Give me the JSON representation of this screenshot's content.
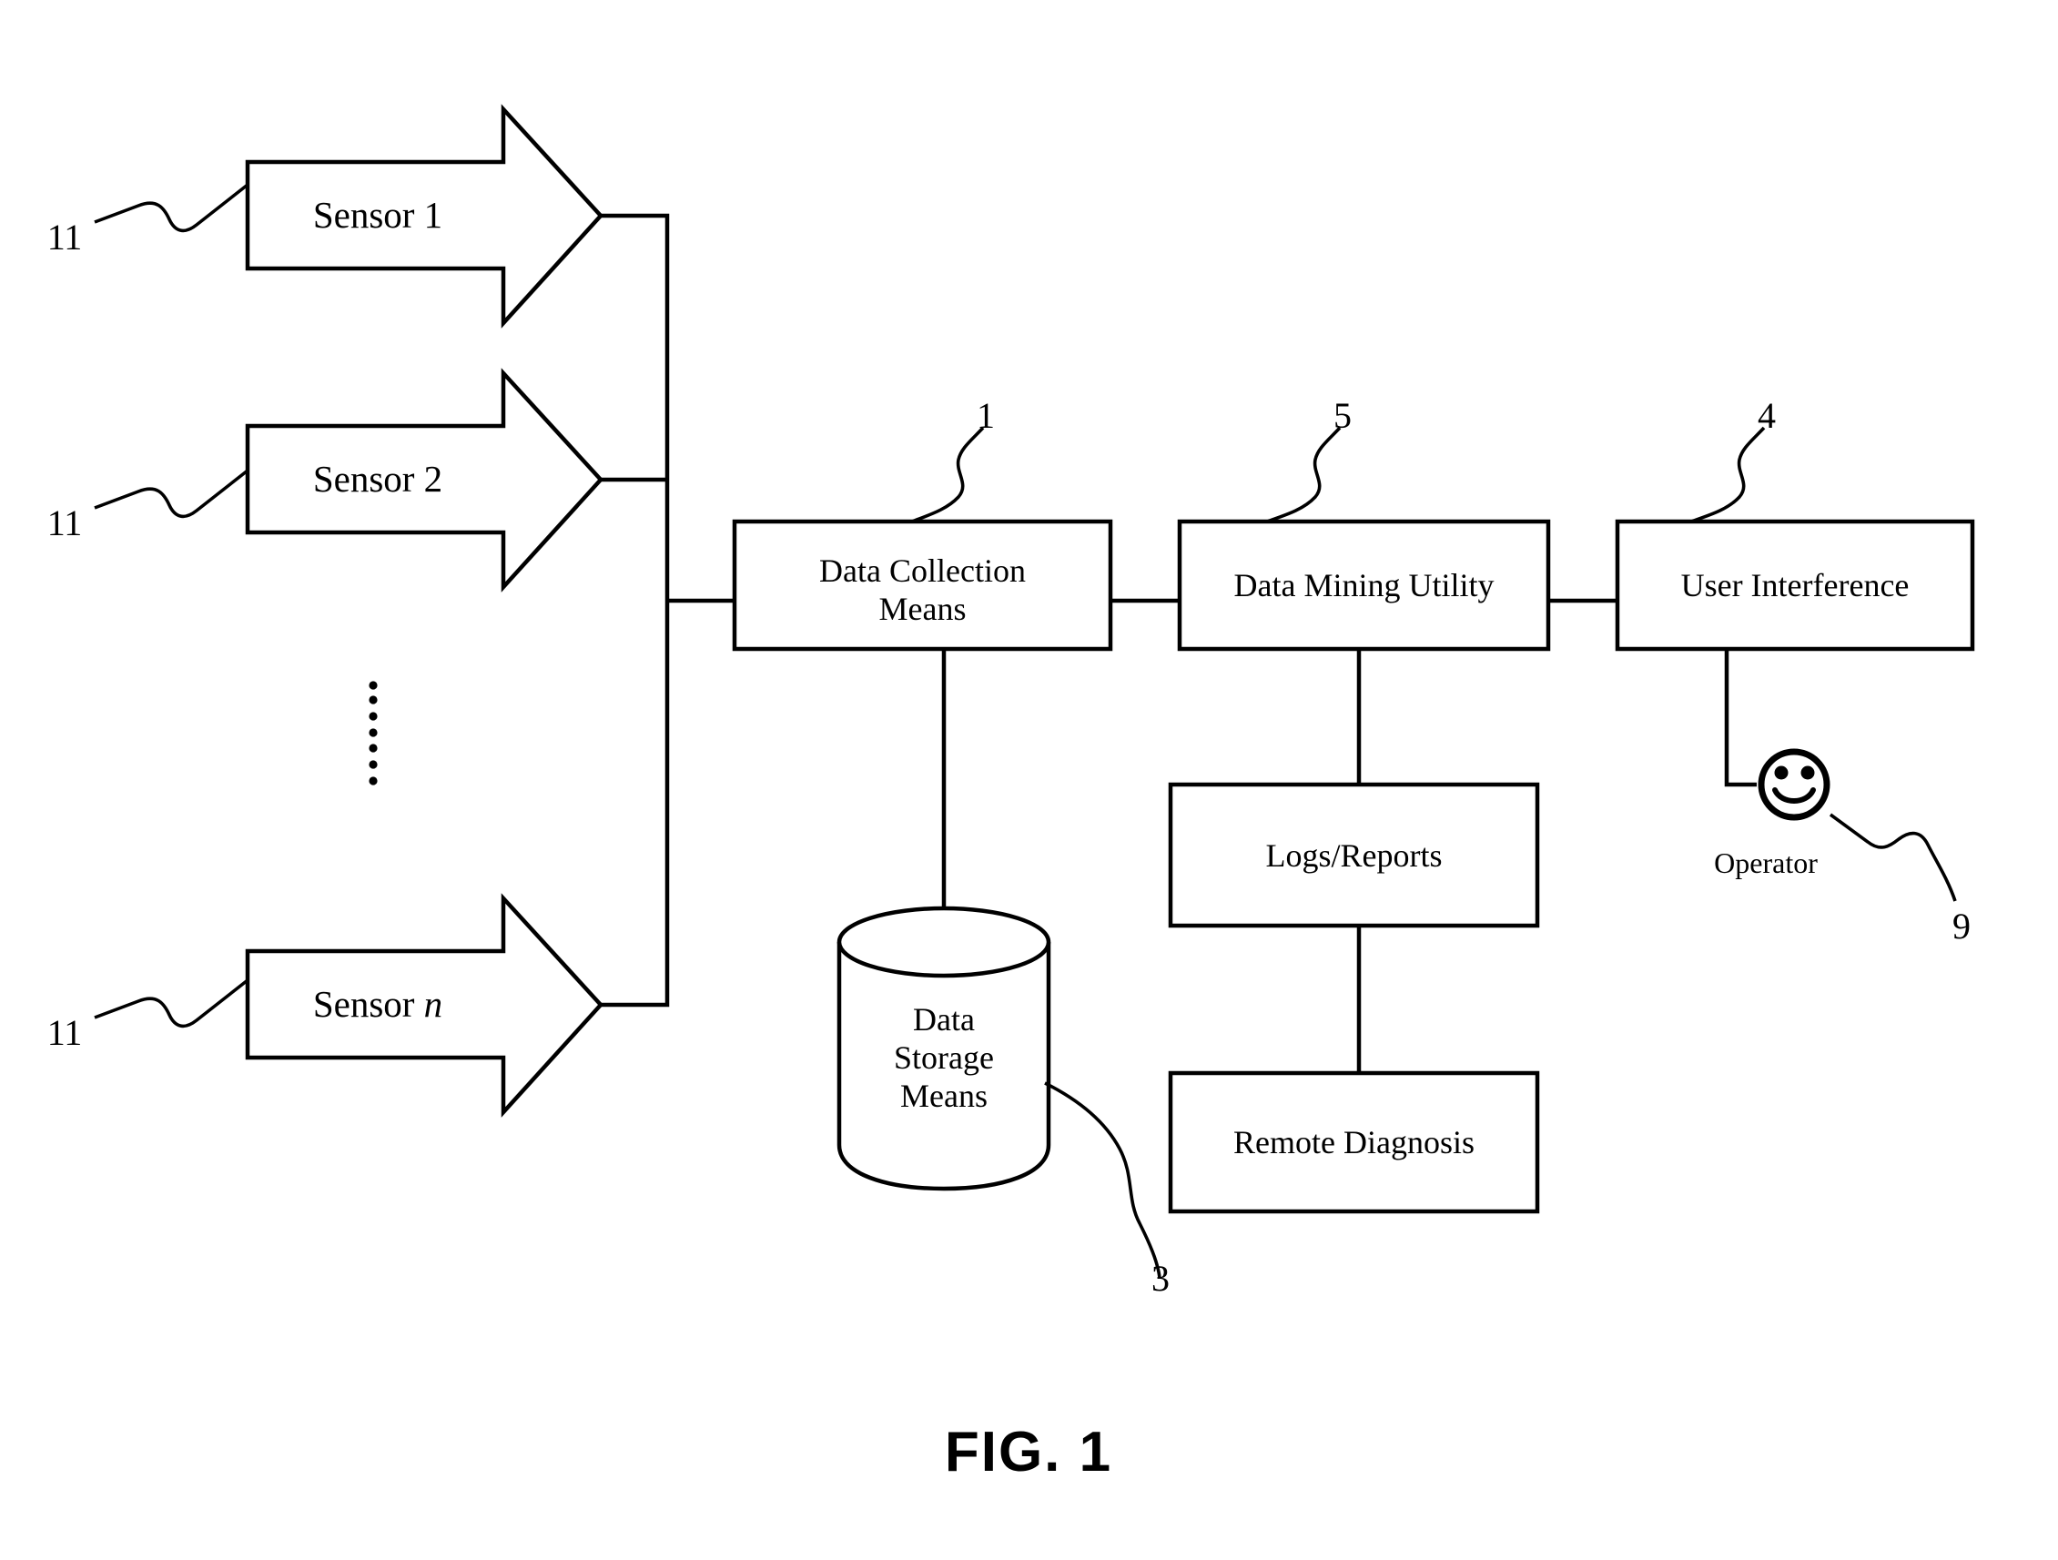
{
  "figure": {
    "caption": "FIG. 1",
    "title_visible": false
  },
  "sensors": [
    {
      "label_prefix": "Sensor ",
      "label_suffix": "1",
      "suffix_italic": false,
      "ref": "11"
    },
    {
      "label_prefix": "Sensor ",
      "label_suffix": "2",
      "suffix_italic": false,
      "ref": "11"
    },
    {
      "label_prefix": "Sensor ",
      "label_suffix": "n",
      "suffix_italic": true,
      "ref": "11"
    }
  ],
  "ellipsis": {
    "name": "vertical-ellipsis",
    "dots": 7
  },
  "blocks": {
    "data_collection": {
      "line1": "Data Collection",
      "line2": "Means",
      "ref": "1"
    },
    "data_mining": {
      "line1": "Data Mining Utility",
      "ref": "5"
    },
    "user_interference": {
      "line1": "User Interference",
      "ref": "4"
    },
    "logs_reports": {
      "line1": "Logs/Reports",
      "ref": ""
    },
    "remote_diagnosis": {
      "line1": "Remote Diagnosis",
      "ref": ""
    },
    "data_storage": {
      "line1": "Data",
      "line2": "Storage",
      "line3": "Means",
      "ref": "3"
    }
  },
  "operator": {
    "label": "Operator",
    "ref": "9",
    "icon": "smiley-face-icon"
  },
  "colors": {
    "stroke": "#000000",
    "fill": "#ffffff",
    "background": "#ffffff"
  }
}
